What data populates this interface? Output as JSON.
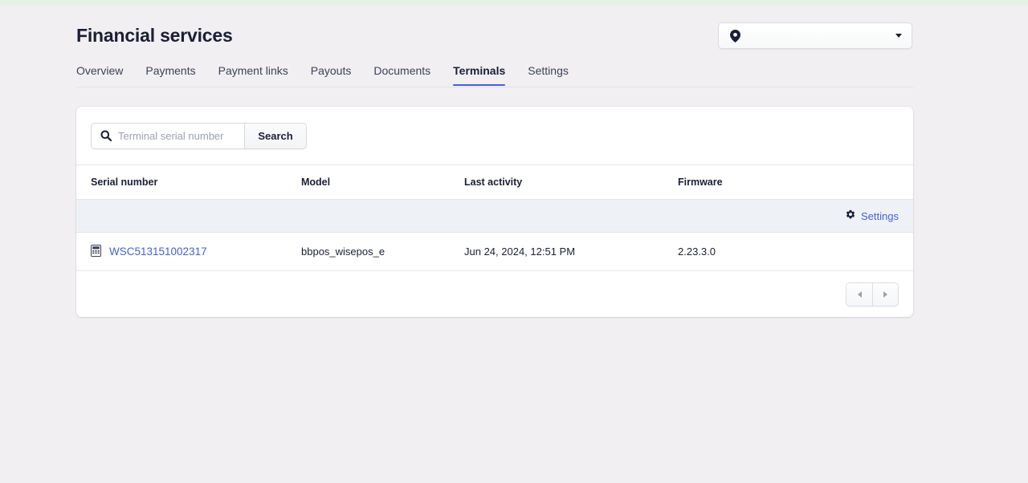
{
  "theme": {
    "page_background": "#f1eff2",
    "card_background": "#ffffff",
    "accent": "#4361d9",
    "text": "#1a1f36",
    "settings_row_background": "#eef1f6",
    "top_strip": "#e3f2e4"
  },
  "header": {
    "title": "Financial services",
    "location_picker": {
      "icon": "location-pin-icon",
      "value": "",
      "chevron": "chevron-down-icon"
    }
  },
  "tabs": [
    {
      "label": "Overview",
      "active": false
    },
    {
      "label": "Payments",
      "active": false
    },
    {
      "label": "Payment links",
      "active": false
    },
    {
      "label": "Payouts",
      "active": false
    },
    {
      "label": "Documents",
      "active": false
    },
    {
      "label": "Terminals",
      "active": true
    },
    {
      "label": "Settings",
      "active": false
    }
  ],
  "toolbar": {
    "search_icon": "search-icon",
    "search_placeholder": "Terminal serial number",
    "search_value": "",
    "search_button_label": "Search"
  },
  "table": {
    "columns": [
      {
        "key": "serial",
        "label": "Serial number"
      },
      {
        "key": "model",
        "label": "Model"
      },
      {
        "key": "last_activity",
        "label": "Last activity"
      },
      {
        "key": "firmware",
        "label": "Firmware"
      }
    ],
    "settings_row": {
      "icon": "gear-icon",
      "label": "Settings"
    },
    "rows": [
      {
        "icon": "terminal-device-icon",
        "serial": "WSC513151002317",
        "model": "bbpos_wisepos_e",
        "last_activity": "Jun 24, 2024, 12:51 PM",
        "firmware": "2.23.3.0"
      }
    ]
  },
  "pagination": {
    "previous_icon": "chevron-left-icon",
    "next_icon": "chevron-right-icon",
    "previous_enabled": false,
    "next_enabled": false
  }
}
